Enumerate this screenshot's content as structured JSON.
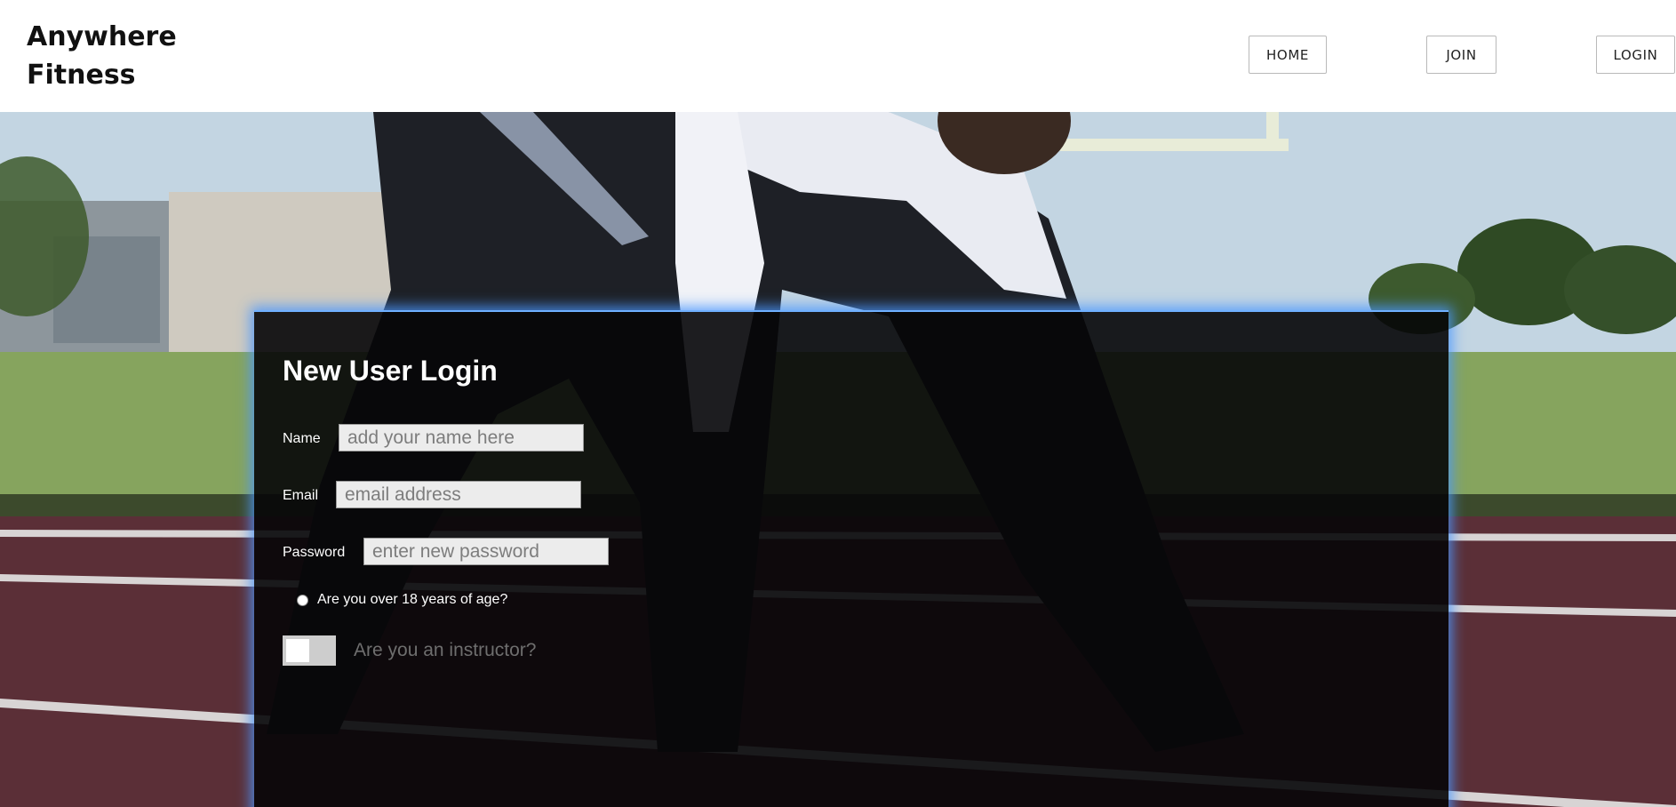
{
  "header": {
    "brand_line1": "Anywhere",
    "brand_line2": "Fitness",
    "nav": {
      "home": "HOME",
      "join": "JOIN",
      "login": "LOGIN"
    }
  },
  "form": {
    "title": "New User Login",
    "name": {
      "label": "Name",
      "placeholder": "add your name here",
      "value": ""
    },
    "email": {
      "label": "Email",
      "placeholder": "email address",
      "value": ""
    },
    "password": {
      "label": "Password",
      "placeholder": "enter new password",
      "value": ""
    },
    "age_check": {
      "label": "Are you over 18 years of age?",
      "checked": false
    },
    "instructor_toggle": {
      "label": "Are you an instructor?",
      "on": false
    }
  },
  "colors": {
    "card_glow": "#4a96ff",
    "card_background": "#060608",
    "text_primary": "#ffffff"
  }
}
